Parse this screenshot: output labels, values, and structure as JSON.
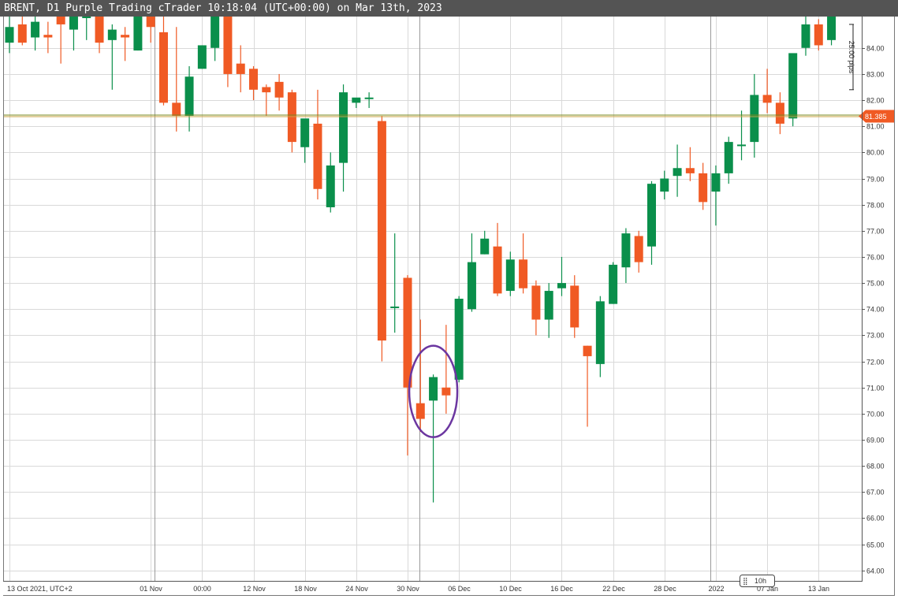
{
  "window": {
    "title": "BRENT, D1 Purple Trading cTrader 10:18:04 (UTC+00:00) on Mar 13th, 2023"
  },
  "colors": {
    "bull": "#0a8f4b",
    "bear": "#f05a24",
    "grid": "#d9d9d9",
    "price_line": "#7a8b1f",
    "price_tag": "#f05a24",
    "circle": "#6b36a0"
  },
  "chart_data": {
    "type": "candlestick",
    "symbol": "BRENT",
    "timeframe": "D1",
    "ylim": [
      63.6,
      85.2
    ],
    "y_ticks": [
      "64.00",
      "65.00",
      "66.00",
      "67.00",
      "68.00",
      "69.00",
      "70.00",
      "71.00",
      "72.00",
      "73.00",
      "74.00",
      "75.00",
      "76.00",
      "77.00",
      "78.00",
      "79.00",
      "80.00",
      "81.00",
      "82.00",
      "83.00",
      "84.00"
    ],
    "x_labels": [
      {
        "i": 0,
        "label": "13 Oct 2021, UTC+2"
      },
      {
        "i": 11,
        "label": "01 Nov"
      },
      {
        "i": 15,
        "label": "00:00"
      },
      {
        "i": 19,
        "label": "12 Nov"
      },
      {
        "i": 23,
        "label": "18 Nov"
      },
      {
        "i": 27,
        "label": "24 Nov"
      },
      {
        "i": 31,
        "label": "30 Nov"
      },
      {
        "i": 35,
        "label": "06 Dec"
      },
      {
        "i": 39,
        "label": "10 Dec"
      },
      {
        "i": 43,
        "label": "16 Dec"
      },
      {
        "i": 47,
        "label": "22 Dec"
      },
      {
        "i": 51,
        "label": "28 Dec"
      },
      {
        "i": 55,
        "label": "2022"
      },
      {
        "i": 59,
        "label": "07 Jan"
      },
      {
        "i": 63,
        "label": "13 Jan"
      }
    ],
    "current_price": "81.385",
    "current_price_value": 81.385,
    "pip_ruler": {
      "label": "25.00 pips",
      "from": 84.9,
      "to": 82.4
    },
    "timeframe_box": "10h",
    "candles": [
      {
        "o": 84.2,
        "h": 85.2,
        "l": 83.8,
        "c": 84.8
      },
      {
        "o": 84.9,
        "h": 85.2,
        "l": 84.1,
        "c": 84.2
      },
      {
        "o": 84.4,
        "h": 85.2,
        "l": 83.9,
        "c": 85.0
      },
      {
        "o": 84.5,
        "h": 85.0,
        "l": 83.8,
        "c": 84.4
      },
      {
        "o": 85.2,
        "h": 85.2,
        "l": 83.4,
        "c": 84.9
      },
      {
        "o": 84.7,
        "h": 85.2,
        "l": 83.9,
        "c": 85.2
      },
      {
        "o": 85.2,
        "h": 85.2,
        "l": 84.3,
        "c": 85.2
      },
      {
        "o": 85.2,
        "h": 85.2,
        "l": 83.8,
        "c": 84.2
      },
      {
        "o": 84.3,
        "h": 84.9,
        "l": 82.4,
        "c": 84.7
      },
      {
        "o": 84.5,
        "h": 84.8,
        "l": 83.5,
        "c": 84.4
      },
      {
        "o": 83.9,
        "h": 85.2,
        "l": 83.9,
        "c": 85.2
      },
      {
        "o": 85.2,
        "h": 85.2,
        "l": 84.2,
        "c": 84.8
      },
      {
        "o": 84.6,
        "h": 85.2,
        "l": 81.8,
        "c": 81.9
      },
      {
        "o": 81.9,
        "h": 84.8,
        "l": 80.8,
        "c": 81.4
      },
      {
        "o": 81.4,
        "h": 83.3,
        "l": 80.8,
        "c": 82.9
      },
      {
        "o": 83.2,
        "h": 84.1,
        "l": 83.2,
        "c": 84.1
      },
      {
        "o": 84.0,
        "h": 85.2,
        "l": 83.5,
        "c": 85.2
      },
      {
        "o": 85.2,
        "h": 85.2,
        "l": 82.5,
        "c": 83.0
      },
      {
        "o": 83.4,
        "h": 84.1,
        "l": 82.3,
        "c": 83.0
      },
      {
        "o": 83.2,
        "h": 83.3,
        "l": 82.0,
        "c": 82.4
      },
      {
        "o": 82.5,
        "h": 82.6,
        "l": 81.4,
        "c": 82.3
      },
      {
        "o": 82.7,
        "h": 83.0,
        "l": 81.6,
        "c": 82.1
      },
      {
        "o": 82.3,
        "h": 82.4,
        "l": 80.0,
        "c": 80.4
      },
      {
        "o": 80.2,
        "h": 81.0,
        "l": 79.6,
        "c": 81.3
      },
      {
        "o": 81.1,
        "h": 82.4,
        "l": 78.2,
        "c": 78.6
      },
      {
        "o": 77.9,
        "h": 80.0,
        "l": 77.7,
        "c": 79.5
      },
      {
        "o": 79.6,
        "h": 82.6,
        "l": 78.5,
        "c": 82.3
      },
      {
        "o": 81.9,
        "h": 82.0,
        "l": 81.7,
        "c": 82.1
      },
      {
        "o": 82.1,
        "h": 82.3,
        "l": 81.7,
        "c": 82.1
      },
      {
        "o": 81.2,
        "h": 81.4,
        "l": 72.0,
        "c": 72.8
      },
      {
        "o": 74.1,
        "h": 76.9,
        "l": 73.1,
        "c": 74.1
      },
      {
        "o": 75.2,
        "h": 75.3,
        "l": 68.4,
        "c": 71.0
      },
      {
        "o": 70.4,
        "h": 73.6,
        "l": 69.3,
        "c": 69.8
      },
      {
        "o": 70.5,
        "h": 71.5,
        "l": 66.6,
        "c": 71.4
      },
      {
        "o": 71.0,
        "h": 73.4,
        "l": 70.0,
        "c": 70.7
      },
      {
        "o": 71.3,
        "h": 74.5,
        "l": 71.2,
        "c": 74.4
      },
      {
        "o": 74.0,
        "h": 76.9,
        "l": 73.9,
        "c": 75.8
      },
      {
        "o": 76.1,
        "h": 77.0,
        "l": 76.1,
        "c": 76.7
      },
      {
        "o": 76.4,
        "h": 77.3,
        "l": 74.5,
        "c": 74.6
      },
      {
        "o": 74.7,
        "h": 76.2,
        "l": 74.5,
        "c": 75.9
      },
      {
        "o": 75.9,
        "h": 76.9,
        "l": 74.6,
        "c": 74.8
      },
      {
        "o": 74.9,
        "h": 75.1,
        "l": 73.0,
        "c": 73.6
      },
      {
        "o": 73.6,
        "h": 75.0,
        "l": 72.9,
        "c": 74.7
      },
      {
        "o": 74.8,
        "h": 76.0,
        "l": 74.5,
        "c": 75.0
      },
      {
        "o": 74.9,
        "h": 75.3,
        "l": 72.9,
        "c": 73.3
      },
      {
        "o": 72.6,
        "h": 72.6,
        "l": 69.5,
        "c": 72.2
      },
      {
        "o": 71.9,
        "h": 74.5,
        "l": 71.4,
        "c": 74.3
      },
      {
        "o": 74.2,
        "h": 75.8,
        "l": 74.2,
        "c": 75.7
      },
      {
        "o": 75.6,
        "h": 77.1,
        "l": 75.0,
        "c": 76.9
      },
      {
        "o": 76.8,
        "h": 77.0,
        "l": 75.4,
        "c": 75.8
      },
      {
        "o": 76.4,
        "h": 78.9,
        "l": 75.7,
        "c": 78.8
      },
      {
        "o": 78.5,
        "h": 79.3,
        "l": 78.2,
        "c": 79.0
      },
      {
        "o": 79.1,
        "h": 80.3,
        "l": 78.3,
        "c": 79.4
      },
      {
        "o": 79.4,
        "h": 80.2,
        "l": 78.9,
        "c": 79.2
      },
      {
        "o": 79.2,
        "h": 79.6,
        "l": 77.8,
        "c": 78.1
      },
      {
        "o": 78.5,
        "h": 79.5,
        "l": 77.2,
        "c": 79.2
      },
      {
        "o": 79.2,
        "h": 80.6,
        "l": 78.8,
        "c": 80.4
      },
      {
        "o": 80.3,
        "h": 81.6,
        "l": 79.7,
        "c": 80.3
      },
      {
        "o": 80.4,
        "h": 83.0,
        "l": 79.8,
        "c": 82.2
      },
      {
        "o": 82.2,
        "h": 83.2,
        "l": 81.5,
        "c": 81.9
      },
      {
        "o": 81.9,
        "h": 82.3,
        "l": 80.7,
        "c": 81.1
      },
      {
        "o": 81.3,
        "h": 83.0,
        "l": 81.0,
        "c": 83.8
      },
      {
        "o": 84.0,
        "h": 85.2,
        "l": 83.7,
        "c": 84.9
      },
      {
        "o": 84.9,
        "h": 85.1,
        "l": 83.9,
        "c": 84.1
      },
      {
        "o": 84.3,
        "h": 85.2,
        "l": 84.1,
        "c": 85.2
      }
    ],
    "highlight_indices": [
      32,
      33,
      34
    ]
  }
}
